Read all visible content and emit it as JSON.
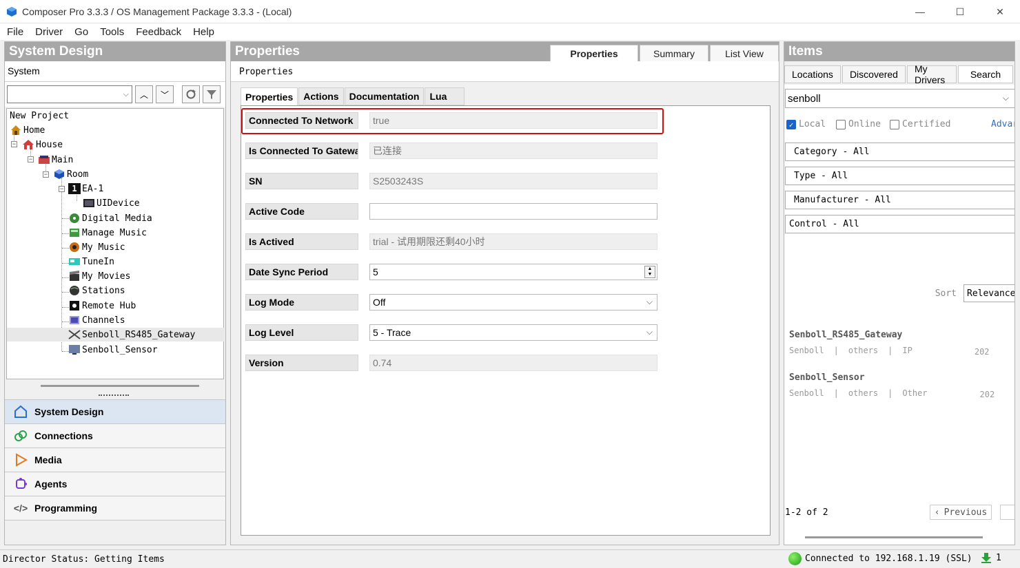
{
  "window": {
    "title": "Composer Pro 3.3.3 / OS Management Package 3.3.3 - (Local)",
    "minimize": "—",
    "maximize": "☐",
    "close": "✕"
  },
  "menu": {
    "file": "File",
    "driver": "Driver",
    "go": "Go",
    "tools": "Tools",
    "feedback": "Feedback",
    "help": "Help"
  },
  "left": {
    "header": "System Design",
    "section": "System",
    "tree": [
      {
        "label": "New Project"
      },
      {
        "label": "Home"
      },
      {
        "label": "House"
      },
      {
        "label": "Main"
      },
      {
        "label": "Room"
      },
      {
        "label": "EA-1"
      },
      {
        "label": "UIDevice"
      },
      {
        "label": "Digital Media"
      },
      {
        "label": "Manage Music"
      },
      {
        "label": "My Music"
      },
      {
        "label": "TuneIn"
      },
      {
        "label": "My Movies"
      },
      {
        "label": "Stations"
      },
      {
        "label": "Remote Hub"
      },
      {
        "label": "Channels"
      },
      {
        "label": "Senboll_RS485_Gateway"
      },
      {
        "label": "Senboll_Sensor"
      }
    ],
    "nav": [
      {
        "label": "System Design"
      },
      {
        "label": "Connections"
      },
      {
        "label": "Media"
      },
      {
        "label": "Agents"
      },
      {
        "label": "Programming"
      }
    ]
  },
  "center": {
    "header": "Properties",
    "top_tabs": [
      "Properties",
      "Summary",
      "List View"
    ],
    "sublabel": "Properties",
    "inner_tabs": [
      "Properties",
      "Actions",
      "Documentation",
      "Lua"
    ],
    "rows": [
      {
        "label": "Connected To Network",
        "value": "true"
      },
      {
        "label": "Is Connected To Gateway",
        "value": "已连接"
      },
      {
        "label": "SN",
        "value": "S2503243S"
      },
      {
        "label": "Active Code",
        "value": ""
      },
      {
        "label": "Is Actived",
        "value": "trial - 试用期限还剩40小时"
      },
      {
        "label": "Date Sync Period",
        "value": "5"
      },
      {
        "label": "Log Mode",
        "value": "Off"
      },
      {
        "label": "Log Level",
        "value": "5 - Trace"
      },
      {
        "label": "Version",
        "value": "0.74"
      }
    ]
  },
  "right": {
    "header": "Items",
    "tabs": [
      "Locations",
      "Discovered",
      "My Drivers",
      "Search"
    ],
    "search_value": "senboll",
    "checks": {
      "local": "Local",
      "online": "Online",
      "certified": "Certified",
      "advanced": "Advar"
    },
    "filters": {
      "category": "Category - All",
      "type": "Type - All",
      "manufacturer": "Manufacturer - All",
      "control": "Control - All"
    },
    "sort_label": "Sort",
    "sort_value": "Relevance",
    "items": [
      {
        "name": "Senboll_RS485_Gateway",
        "maker": "Senboll",
        "category": "others",
        "conn": "IP",
        "year": "202"
      },
      {
        "name": "Senboll_Sensor",
        "maker": "Senboll",
        "category": "others",
        "conn": "Other",
        "year": "202"
      }
    ],
    "pager_count": "1-2 of 2",
    "prev_label": "Previous"
  },
  "status": {
    "left": "Director Status: Getting Items",
    "connection": "Connected to 192.168.1.19 (SSL)",
    "downloads": "1"
  }
}
